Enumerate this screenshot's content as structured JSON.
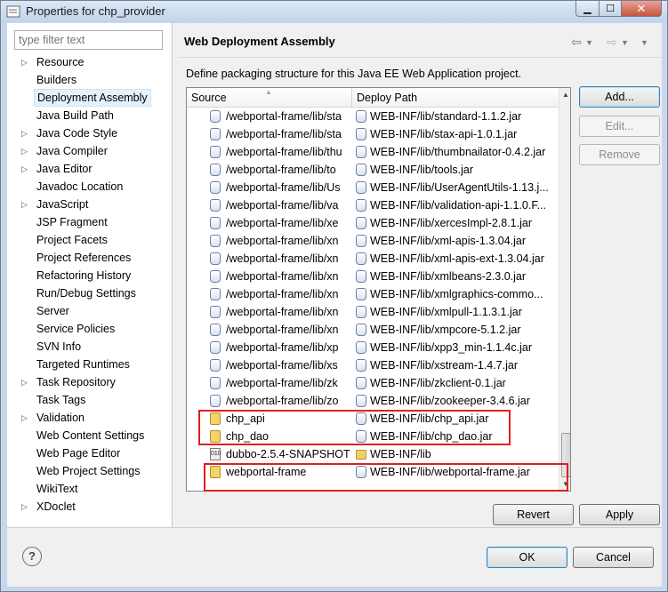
{
  "window": {
    "title": "Properties for chp_provider"
  },
  "sidebar": {
    "filter_placeholder": "type filter text",
    "items": [
      {
        "label": "Resource",
        "expandable": true
      },
      {
        "label": "Builders",
        "expandable": false
      },
      {
        "label": "Deployment Assembly",
        "expandable": false,
        "selected": true
      },
      {
        "label": "Java Build Path",
        "expandable": false
      },
      {
        "label": "Java Code Style",
        "expandable": true
      },
      {
        "label": "Java Compiler",
        "expandable": true
      },
      {
        "label": "Java Editor",
        "expandable": true
      },
      {
        "label": "Javadoc Location",
        "expandable": false
      },
      {
        "label": "JavaScript",
        "expandable": true
      },
      {
        "label": "JSP Fragment",
        "expandable": false
      },
      {
        "label": "Project Facets",
        "expandable": false
      },
      {
        "label": "Project References",
        "expandable": false
      },
      {
        "label": "Refactoring History",
        "expandable": false
      },
      {
        "label": "Run/Debug Settings",
        "expandable": false
      },
      {
        "label": "Server",
        "expandable": false
      },
      {
        "label": "Service Policies",
        "expandable": false
      },
      {
        "label": "SVN Info",
        "expandable": false
      },
      {
        "label": "Targeted Runtimes",
        "expandable": false
      },
      {
        "label": "Task Repository",
        "expandable": true
      },
      {
        "label": "Task Tags",
        "expandable": false
      },
      {
        "label": "Validation",
        "expandable": true
      },
      {
        "label": "Web Content Settings",
        "expandable": false
      },
      {
        "label": "Web Page Editor",
        "expandable": false
      },
      {
        "label": "Web Project Settings",
        "expandable": false
      },
      {
        "label": "WikiText",
        "expandable": false
      },
      {
        "label": "XDoclet",
        "expandable": true
      }
    ]
  },
  "page": {
    "title": "Web Deployment Assembly",
    "description": "Define packaging structure for this Java EE Web Application project."
  },
  "table": {
    "columns": [
      "Source",
      "Deploy Path"
    ],
    "rows": [
      {
        "icon": "jar-icon",
        "source": "/webportal-frame/lib/sta",
        "deploy": "WEB-INF/lib/standard-1.1.2.jar"
      },
      {
        "icon": "jar-icon",
        "source": "/webportal-frame/lib/sta",
        "deploy": "WEB-INF/lib/stax-api-1.0.1.jar"
      },
      {
        "icon": "jar-icon",
        "source": "/webportal-frame/lib/thu",
        "deploy": "WEB-INF/lib/thumbnailator-0.4.2.jar"
      },
      {
        "icon": "jar-icon",
        "source": "/webportal-frame/lib/to",
        "deploy": "WEB-INF/lib/tools.jar"
      },
      {
        "icon": "jar-icon",
        "source": "/webportal-frame/lib/Us",
        "deploy": "WEB-INF/lib/UserAgentUtils-1.13.j..."
      },
      {
        "icon": "jar-icon",
        "source": "/webportal-frame/lib/va",
        "deploy": "WEB-INF/lib/validation-api-1.1.0.F..."
      },
      {
        "icon": "jar-icon",
        "source": "/webportal-frame/lib/xe",
        "deploy": "WEB-INF/lib/xercesImpl-2.8.1.jar"
      },
      {
        "icon": "jar-icon",
        "source": "/webportal-frame/lib/xn",
        "deploy": "WEB-INF/lib/xml-apis-1.3.04.jar"
      },
      {
        "icon": "jar-icon",
        "source": "/webportal-frame/lib/xn",
        "deploy": "WEB-INF/lib/xml-apis-ext-1.3.04.jar"
      },
      {
        "icon": "jar-icon",
        "source": "/webportal-frame/lib/xn",
        "deploy": "WEB-INF/lib/xmlbeans-2.3.0.jar"
      },
      {
        "icon": "jar-icon",
        "source": "/webportal-frame/lib/xn",
        "deploy": "WEB-INF/lib/xmlgraphics-commo..."
      },
      {
        "icon": "jar-icon",
        "source": "/webportal-frame/lib/xn",
        "deploy": "WEB-INF/lib/xmlpull-1.1.3.1.jar"
      },
      {
        "icon": "jar-icon",
        "source": "/webportal-frame/lib/xn",
        "deploy": "WEB-INF/lib/xmpcore-5.1.2.jar"
      },
      {
        "icon": "jar-icon",
        "source": "/webportal-frame/lib/xp",
        "deploy": "WEB-INF/lib/xpp3_min-1.1.4c.jar"
      },
      {
        "icon": "jar-icon",
        "source": "/webportal-frame/lib/xs",
        "deploy": "WEB-INF/lib/xstream-1.4.7.jar"
      },
      {
        "icon": "jar-icon",
        "source": "/webportal-frame/lib/zk",
        "deploy": "WEB-INF/lib/zkclient-0.1.jar"
      },
      {
        "icon": "jar-icon",
        "source": "/webportal-frame/lib/zo",
        "deploy": "WEB-INF/lib/zookeeper-3.4.6.jar"
      },
      {
        "icon": "project-icon",
        "source": "chp_api",
        "deploy": "WEB-INF/lib/chp_api.jar"
      },
      {
        "icon": "project-icon",
        "source": "chp_dao",
        "deploy": "WEB-INF/lib/chp_dao.jar"
      },
      {
        "icon": "archive-icon",
        "source": "dubbo-2.5.4-SNAPSHOT",
        "deploy": "WEB-INF/lib",
        "deploy_icon": "folder-icon"
      },
      {
        "icon": "project-icon",
        "source": "webportal-frame",
        "deploy": "WEB-INF/lib/webportal-frame.jar"
      }
    ]
  },
  "buttons": {
    "add": "Add...",
    "edit": "Edit...",
    "remove": "Remove",
    "revert": "Revert",
    "apply": "Apply",
    "ok": "OK",
    "cancel": "Cancel",
    "help": "?"
  },
  "colors": {
    "highlight": "#e02020",
    "selection": "#e5f1fb"
  }
}
